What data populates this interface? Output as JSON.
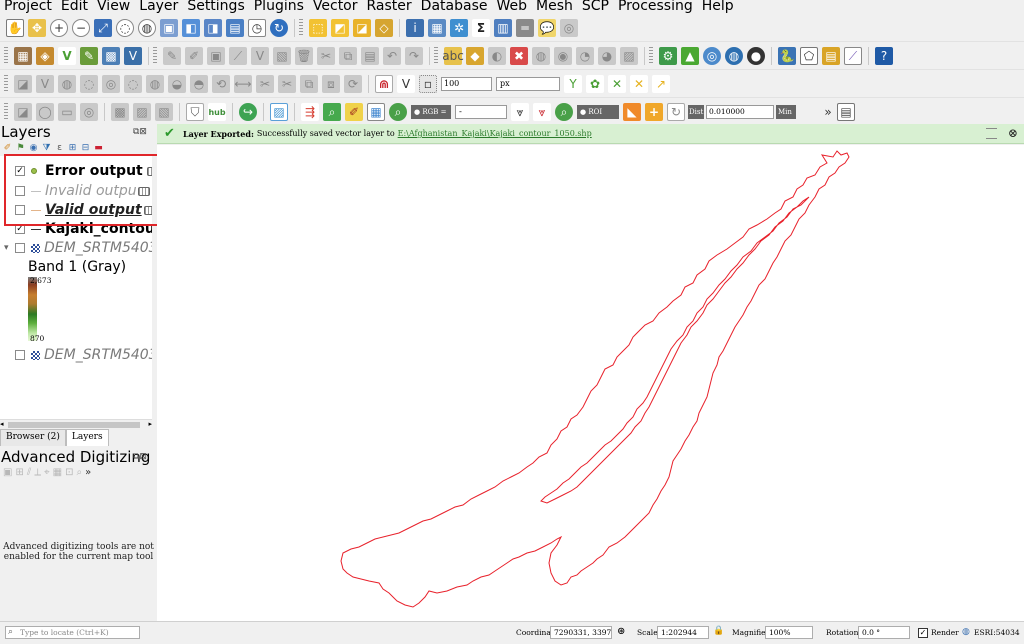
{
  "menu": [
    "Project",
    "Edit",
    "View",
    "Layer",
    "Settings",
    "Plugins",
    "Vector",
    "Raster",
    "Database",
    "Web",
    "Mesh",
    "SCP",
    "Processing",
    "Help"
  ],
  "scp_toolbar": {
    "rgb_label": "RGB =",
    "rgb_value": "-",
    "roi_label": "ROI",
    "dist_label": "Dist",
    "dist_value": "0.010000",
    "min_label": "Min",
    "hub_label": "hub"
  },
  "snapping": {
    "tolerance": "100",
    "unit": "px"
  },
  "layers_panel": {
    "title": "Layers",
    "items": [
      {
        "name": "Error output",
        "checked": true,
        "style": "bold-green"
      },
      {
        "name": "Invalid outpu",
        "checked": false,
        "style": "italic-gray"
      },
      {
        "name": "Valid output",
        "checked": false,
        "style": "italic-underline"
      },
      {
        "name": "Kajaki_contour_",
        "checked": true,
        "style": "plain"
      },
      {
        "name": "DEM_SRTM5403",
        "checked": false,
        "style": "raster-italic"
      },
      {
        "name": "Band 1 (Gray)",
        "style": "legend"
      },
      {
        "name": "DEM_SRTM5403",
        "checked": false,
        "style": "raster-italic"
      }
    ],
    "legend_max": "2,673",
    "legend_min": "870",
    "tabs": [
      "Browser (2)",
      "Layers"
    ]
  },
  "advanced_digitizing": {
    "title": "Advanced Digitizing",
    "message": "Advanced digitizing tools are not enabled for the current map tool"
  },
  "message_bar": {
    "title": "Layer Exported:",
    "text": "Successfully saved vector layer to",
    "link": "E:\\Afghanistan_Kajaki\\Kajaki_contour_1050.shp"
  },
  "status": {
    "locate_placeholder": "Type to locate (Ctrl+K)",
    "coordinate_label": "Coordinate",
    "coordinate_value": "7290331, 3397506",
    "scale_label": "Scale",
    "scale_value": "1:202944",
    "magnifier_label": "Magnifier",
    "magnifier_value": "100%",
    "rotation_label": "Rotation",
    "rotation_value": "0.0 °",
    "render_label": "Render",
    "crs_value": "ESRI:54034"
  },
  "colors": {
    "annotation_red": "#e0262a",
    "contour_red": "#e8212b",
    "message_green": "#d8f0d2"
  }
}
